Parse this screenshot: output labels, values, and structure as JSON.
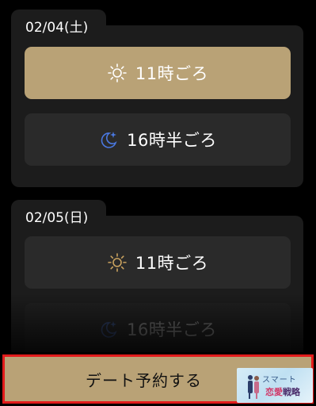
{
  "days": [
    {
      "date": "02/04(土)",
      "slots": [
        {
          "label": "11時ごろ",
          "icon": "sun-icon",
          "selected": true
        },
        {
          "label": "16時半ごろ",
          "icon": "moon-star-icon",
          "selected": false
        }
      ]
    },
    {
      "date": "02/05(日)",
      "slots": [
        {
          "label": "11時ごろ",
          "icon": "sun-icon",
          "selected": false
        },
        {
          "label": "16時半ごろ",
          "icon": "moon-star-icon",
          "selected": false
        }
      ]
    }
  ],
  "footer": {
    "reserve_label": "デート予約する"
  },
  "brand": {
    "line1": "スマート",
    "line2a": "恋愛",
    "line2b": "戦略"
  },
  "colors": {
    "accent": "#b9a276",
    "card": "#1c1c1c",
    "slot": "#2a2a2a",
    "sun": "#c9a25f",
    "moon": "#4a78e0",
    "highlight_border": "#e21b1b"
  }
}
